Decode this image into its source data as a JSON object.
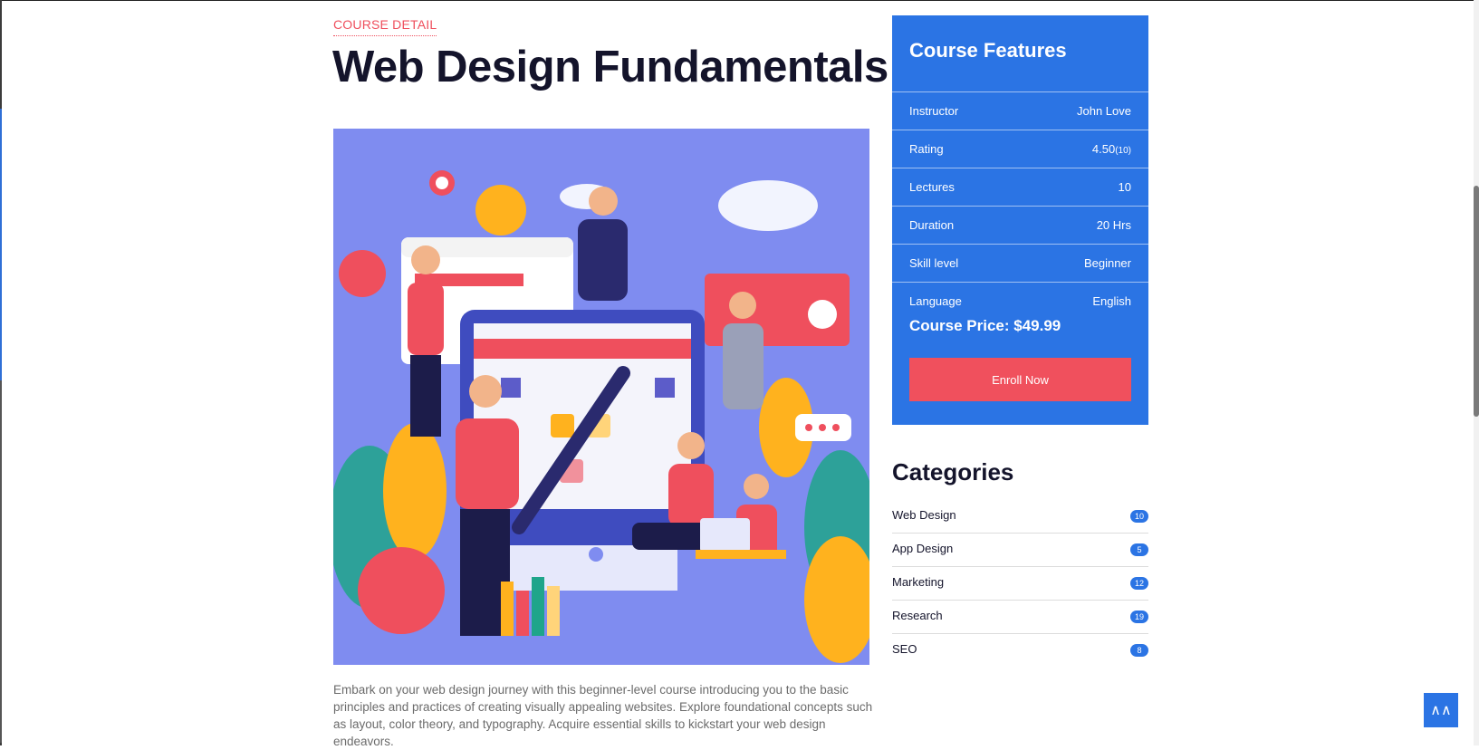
{
  "header": {
    "eyebrow": "COURSE DETAIL",
    "title": "Web Design Fundamentals"
  },
  "description": "Embark on your web design journey with this beginner-level course introducing you to the basic principles and practices of creating visually appealing websites. Explore foundational concepts such as layout, color theory, and typography. Acquire essential skills to kickstart your web design endeavors.",
  "features": {
    "title": "Course Features",
    "rows": [
      {
        "label": "Instructor",
        "value": "John Love",
        "extra": ""
      },
      {
        "label": "Rating",
        "value": "4.50",
        "extra": "(10)"
      },
      {
        "label": "Lectures",
        "value": "10",
        "extra": ""
      },
      {
        "label": "Duration",
        "value": "20 Hrs",
        "extra": ""
      },
      {
        "label": "Skill level",
        "value": "Beginner",
        "extra": ""
      },
      {
        "label": "Language",
        "value": "English",
        "extra": ""
      }
    ],
    "price": "Course Price: $49.99",
    "enroll_label": "Enroll Now"
  },
  "categories": {
    "title": "Categories",
    "items": [
      {
        "name": "Web Design",
        "count": "10"
      },
      {
        "name": "App Design",
        "count": "5"
      },
      {
        "name": "Marketing",
        "count": "12"
      },
      {
        "name": "Research",
        "count": "19"
      },
      {
        "name": "SEO",
        "count": "8"
      }
    ]
  },
  "to_top_icon": "double-chevron-up-icon",
  "colors": {
    "accent_blue": "#2b74e4",
    "accent_red": "#f0505d",
    "title_dark": "#14142b"
  }
}
